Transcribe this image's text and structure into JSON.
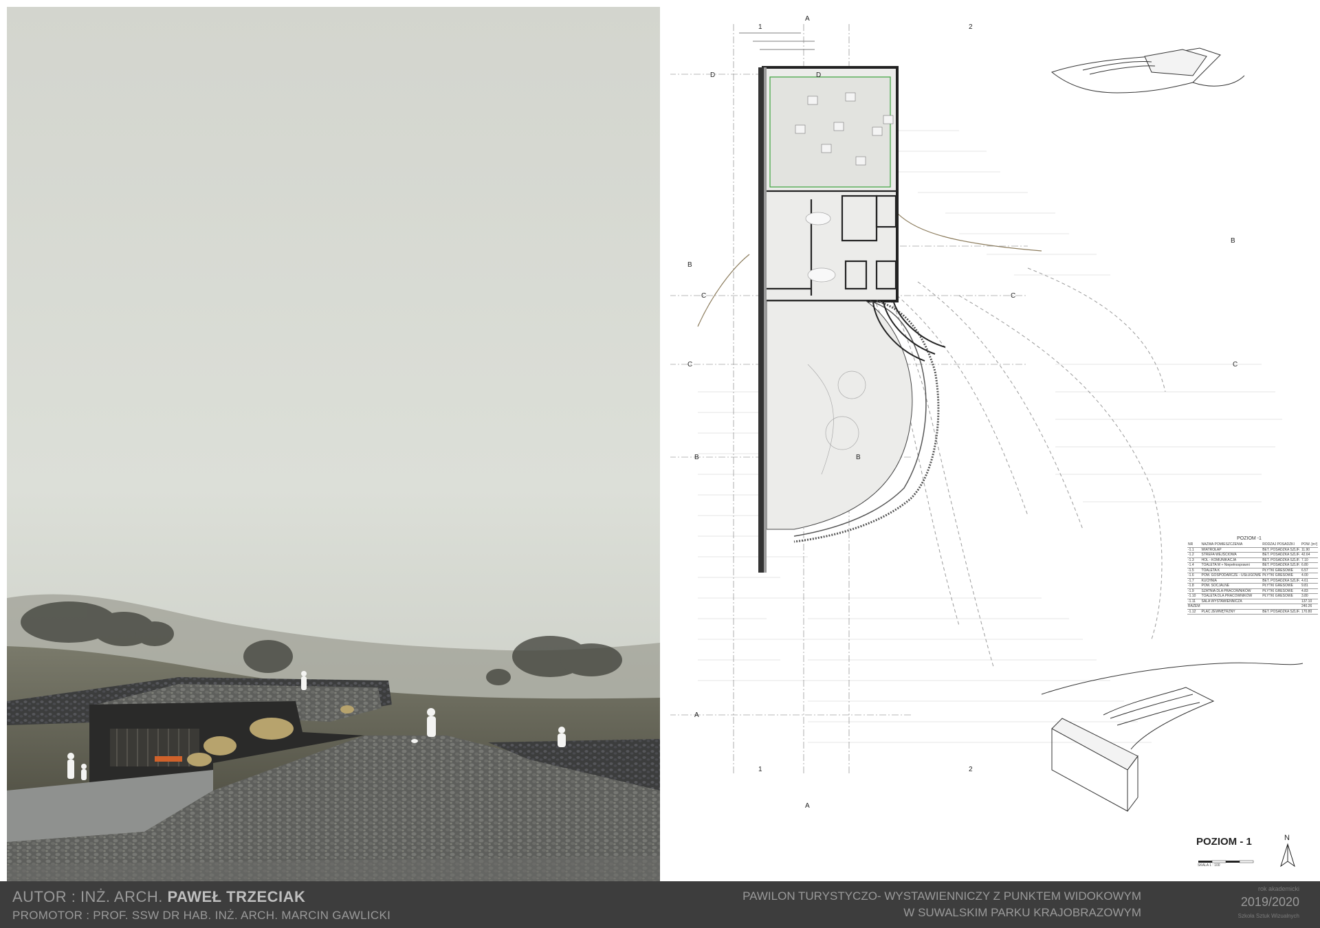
{
  "footer": {
    "author_prefix": "AUTOR : INŻ. ARCH.",
    "author_name": "PAWEŁ TRZECIAK",
    "promotor": "PROMOTOR : PROF. SSW DR HAB. INŻ. ARCH. MARCIN GAWLICKI",
    "project_title_line1": "PAWILON TURYSTYCZO- WYSTAWIENNICZY Z PUNKTEM WIDOKOWYM",
    "project_title_line2": "W SUWALSKIM PARKU KRAJOBRAZOWYM",
    "semester_label": "rok akademicki",
    "year": "2019/2020",
    "school": "Szkoła Sztuk Wizualnych"
  },
  "plan": {
    "level_label": "POZIOM - 1",
    "scale_label": "SKALA 1 : 100",
    "north_letter": "N",
    "section_marks": {
      "a": "A",
      "b": "B",
      "c": "C",
      "d": "D"
    },
    "axis_marks": {
      "one": "1",
      "two": "2"
    }
  },
  "legend": {
    "title": "POZIOM -1",
    "header": [
      "NR",
      "NAZWA POMIESZCZENIA",
      "RODZAJ POSADZKI",
      "POW. [m²]"
    ],
    "rows": [
      [
        "-1.1",
        "WIATROŁAP",
        "BET. POSADZKA SZLIF.",
        "11.90"
      ],
      [
        "-1.2",
        "STREFA WEJŚCIOWA",
        "BET. POSADZKA SZLIF.",
        "42.64"
      ],
      [
        "-1.3",
        "HOL - KOMUNIKACJA",
        "BET. POSADZKA SZLIF.",
        "7.10"
      ],
      [
        "-1.4",
        "TOALETA M + Niepełnosprawni",
        "BET. POSADZKA SZLIF.",
        "6.80"
      ],
      [
        "-1.5",
        "TOALETA K",
        "PŁYTKI GRESOWE",
        "6.57"
      ],
      [
        "-1.6",
        "POM. GOSPODARCZE - USŁUGOWE",
        "PŁYTKI GRESOWE",
        "4.00"
      ],
      [
        "-1.7",
        "KUCHNIA",
        "BET. POSADZKA SZLIF.",
        "4.61"
      ],
      [
        "-1.8",
        "POM. SOCJALNE",
        "PŁYTKI GRESOWE",
        "9.81"
      ],
      [
        "-1.9",
        "SZATNIA DLA PRACOWNIKÓW",
        "PŁYTKI GRESOWE",
        "4.83"
      ],
      [
        "-1.10",
        "TOALETA DLA PRACOWNIKÓW",
        "PŁYTKI GRESOWE",
        "3.80"
      ],
      [
        "-1.11",
        "SALA WYSTAWIENNICZA",
        "",
        "137.10"
      ]
    ],
    "total_label": "RAZEM",
    "total_value": "240.26",
    "extra": [
      "-1.12",
      "PLAC ZEWNĘTRZNY",
      "BET. POSADZKA SZLIF.",
      "170.80"
    ]
  },
  "colors": {
    "footer_bg": "#3d3d3d",
    "footer_text": "#9a9a9a",
    "fog": "#d9dbd3",
    "stone": "#5b5b5b",
    "grass": "#4d4b3c",
    "plan_line": "#333333",
    "plan_fill": "#e6e6e3",
    "green_line": "#3aa23a"
  }
}
